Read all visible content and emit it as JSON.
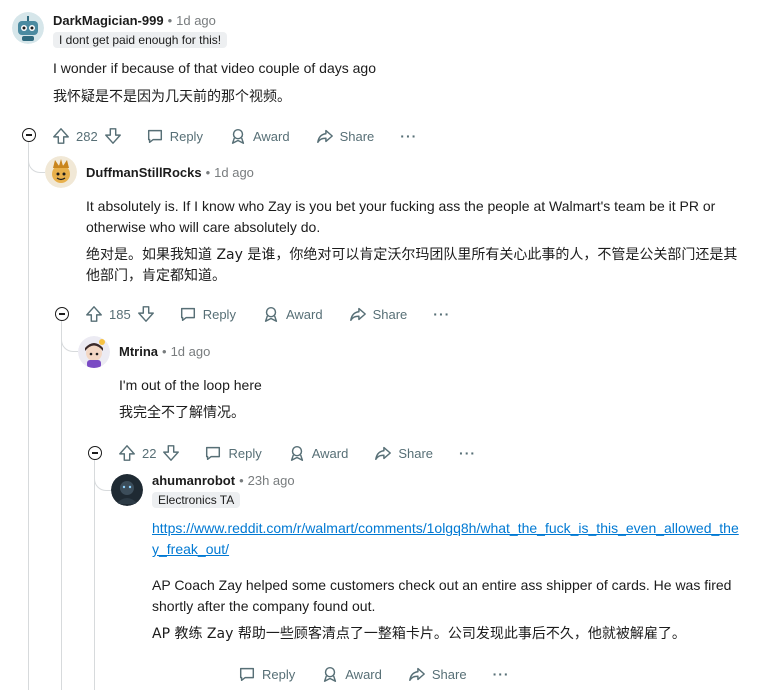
{
  "comments": [
    {
      "username": "DarkMagician-999",
      "time": "1d ago",
      "flair": "I dont get paid enough for this!",
      "text_en": "I wonder if because of that video couple of days ago",
      "text_zh": "我怀疑是不是因为几天前的那个视频。",
      "votes": "282"
    },
    {
      "username": "DuffmanStillRocks",
      "time": "1d ago",
      "text_en_line1": "It absolutely is. If I know who Zay is you bet your fucking ass the people at Walmart's team be it PR or",
      "text_en_line2": "otherwise who will care absolutely do.",
      "text_zh_line1": "绝对是。如果我知道 Zay 是谁，你绝对可以肯定沃尔玛团队里所有关心此事的人，不管是公关部门还是其",
      "text_zh_line2": "他部门，肯定都知道。",
      "votes": "185"
    },
    {
      "username": "Mtrina",
      "time": "1d ago",
      "text_en": "I'm out of the loop here",
      "text_zh": "我完全不了解情况。",
      "votes": "22"
    },
    {
      "username": "ahumanrobot",
      "time": "23h ago",
      "flair": "Electronics TA",
      "link_line1": "https://www.reddit.com/r/walmart/comments/1olgq8h/what_the_fuck_is_this_even_allowed_the",
      "link_line2": "y_freak_out/",
      "text_en_line1": "AP Coach Zay helped some customers check out an entire ass shipper of cards. He was fired",
      "text_en_line2": "shortly after the company found out.",
      "text_zh": "AP 教练 Zay 帮助一些顾客清点了一整箱卡片。公司发现此事后不久，他就被解雇了。"
    }
  ],
  "actions": {
    "reply": "Reply",
    "award": "Award",
    "share": "Share",
    "more": "···"
  },
  "icons": [
    "collapse-icon",
    "upvote-icon",
    "downvote-icon",
    "reply-icon",
    "award-icon",
    "share-icon",
    "more-icon"
  ],
  "colors": {
    "meta_gray": "#787c7e",
    "link": "#0079d3",
    "flair_bg": "#edeff1"
  }
}
